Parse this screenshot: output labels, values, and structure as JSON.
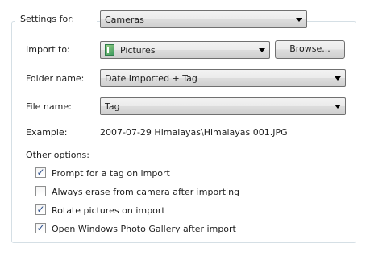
{
  "settings_for": {
    "label": "Settings for:",
    "value": "Cameras"
  },
  "import_to": {
    "label": "Import to:",
    "value": "Pictures",
    "icon": "pictures-folder-icon",
    "browse_label": "Browse..."
  },
  "folder_name": {
    "label": "Folder name:",
    "value": "Date Imported + Tag"
  },
  "file_name": {
    "label": "File name:",
    "value": "Tag"
  },
  "example": {
    "label": "Example:",
    "value": "2007-07-29 Himalayas\\Himalayas 001.JPG"
  },
  "other_options": {
    "label": "Other options:",
    "items": [
      {
        "label": "Prompt for a tag on import",
        "checked": true
      },
      {
        "label": "Always erase from camera after importing",
        "checked": false
      },
      {
        "label": "Rotate pictures on import",
        "checked": true
      },
      {
        "label": "Open Windows Photo Gallery after import",
        "checked": true
      }
    ]
  }
}
